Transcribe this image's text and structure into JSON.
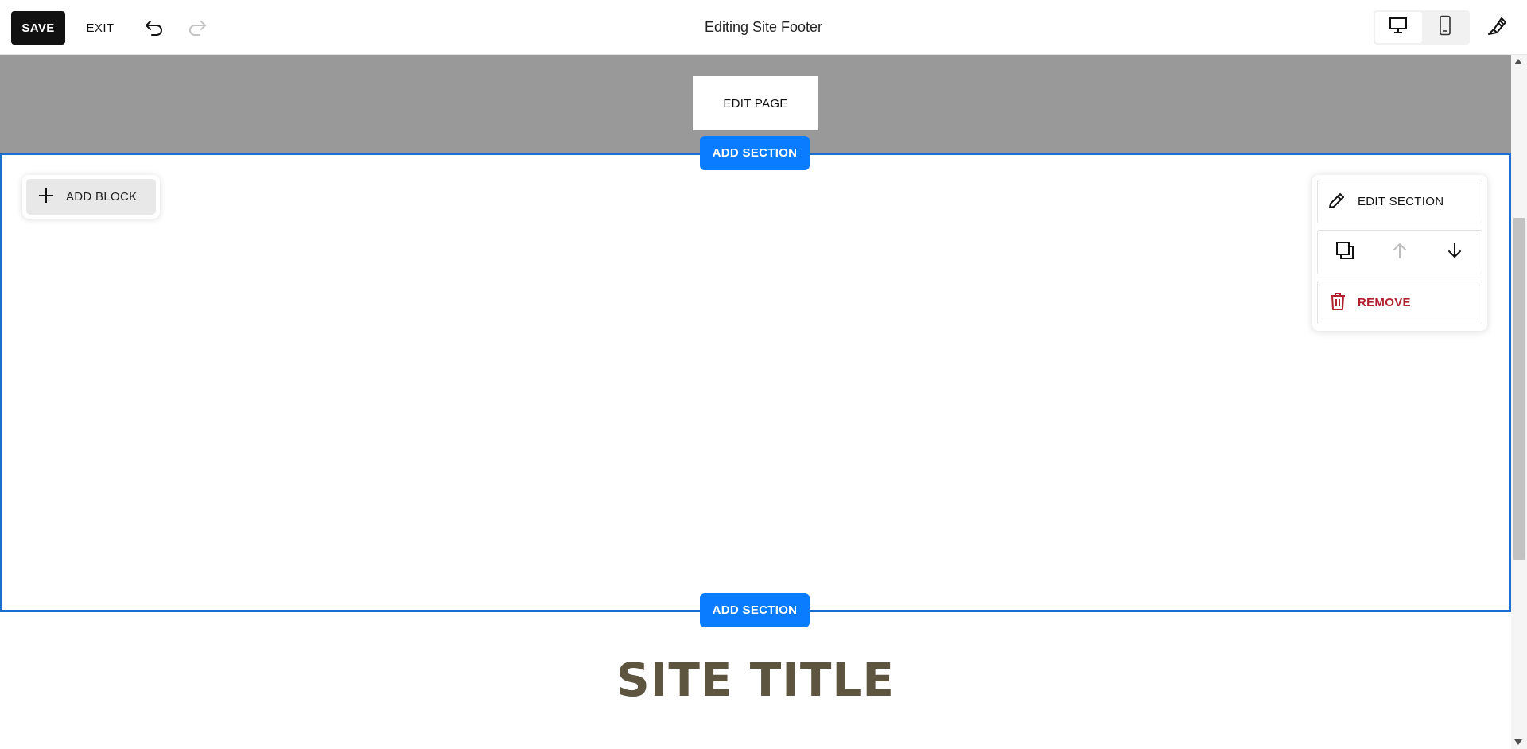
{
  "toolbar": {
    "save_label": "SAVE",
    "exit_label": "EXIT",
    "title": "Editing Site Footer",
    "undo_icon": "undo-icon",
    "redo_icon": "redo-icon",
    "device_modes": [
      "desktop",
      "mobile"
    ],
    "active_device": "desktop",
    "design_icon": "paintbrush-icon"
  },
  "canvas": {
    "header": {
      "edit_page_label": "EDIT PAGE",
      "background": "#999999"
    },
    "add_section_label": "ADD SECTION",
    "add_block_label": "ADD BLOCK",
    "section_panel": {
      "edit_section_label": "EDIT SECTION",
      "remove_label": "REMOVE",
      "actions": [
        "duplicate",
        "move-up",
        "move-down"
      ],
      "move_up_disabled": true
    },
    "site_title": "SITE TITLE"
  },
  "colors": {
    "accent": "#0a7cff",
    "selection_border": "#1a6fd0",
    "remove": "#b3202f",
    "site_title": "#5e5540"
  }
}
